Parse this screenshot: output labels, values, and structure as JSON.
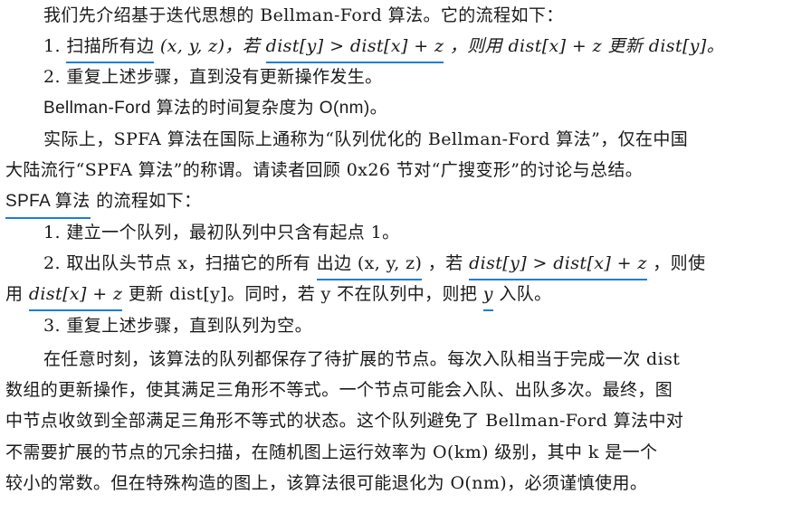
{
  "lines": [
    {
      "a": "我们先介绍基于迭代思想的 Bellman-Ford 算法。它的流程如下："
    },
    {
      "num": "1.",
      "u1": "扫描所有边",
      "a": " (x, y, z)，若 ",
      "u2": "dist[y] > dist[x] + z",
      "b": "，则用 dist[x] + z 更新 dist[y]。"
    },
    {
      "a": "2. 重复上述步骤，直到没有更新操作发生。"
    },
    {
      "a": "Bellman-Ford 算法的时间复杂度为 O(nm)。"
    },
    {
      "a": "实际上，SPFA 算法在国际上通称为“队列优化的 Bellman-Ford 算法”，仅在中国"
    },
    {
      "a": "大陆流行“SPFA 算法”的称谓。请读者回顾 0x26 节对“广搜变形”的讨论与总结。"
    },
    {
      "u1": "SPFA 算法",
      "a": "的流程如下："
    },
    {
      "a": "1. 建立一个队列，最初队列中只含有起点 1。"
    },
    {
      "a": "2. 取出队头节点 x，扫描它的所有",
      "u1": "出边 (x, y, z)",
      "b": "，若 ",
      "u2": "dist[y] > dist[x] + z",
      "c": "，则使"
    },
    {
      "a": "用 ",
      "u1": "dist[x] + z",
      "b": " 更新 dist[y]。同时，若 y 不在队列中，则把 ",
      "u2": "y",
      "c": " 入队。"
    },
    {
      "a": "3. 重复上述步骤，直到队列为空。"
    },
    {
      "a": "在任意时刻，该算法的队列都保存了待扩展的节点。每次入队相当于完成一次 dist"
    },
    {
      "a": "数组的更新操作，使其满足三角形不等式。一个节点可能会入队、出队多次。最终，图"
    },
    {
      "a": "中节点收敛到全部满足三角形不等式的状态。这个队列避免了 Bellman-Ford 算法中对"
    },
    {
      "a": "不需要扩展的节点的冗余扫描，在随机图上运行效率为 O(km) 级别，其中 k 是一个"
    },
    {
      "a": "较小的常数。但在特殊构造的图上，该算法很可能退化为 O(nm)，必须谨慎使用。"
    }
  ],
  "colors": {
    "underline": "#1a7fd6",
    "text": "#1a1a1a"
  }
}
